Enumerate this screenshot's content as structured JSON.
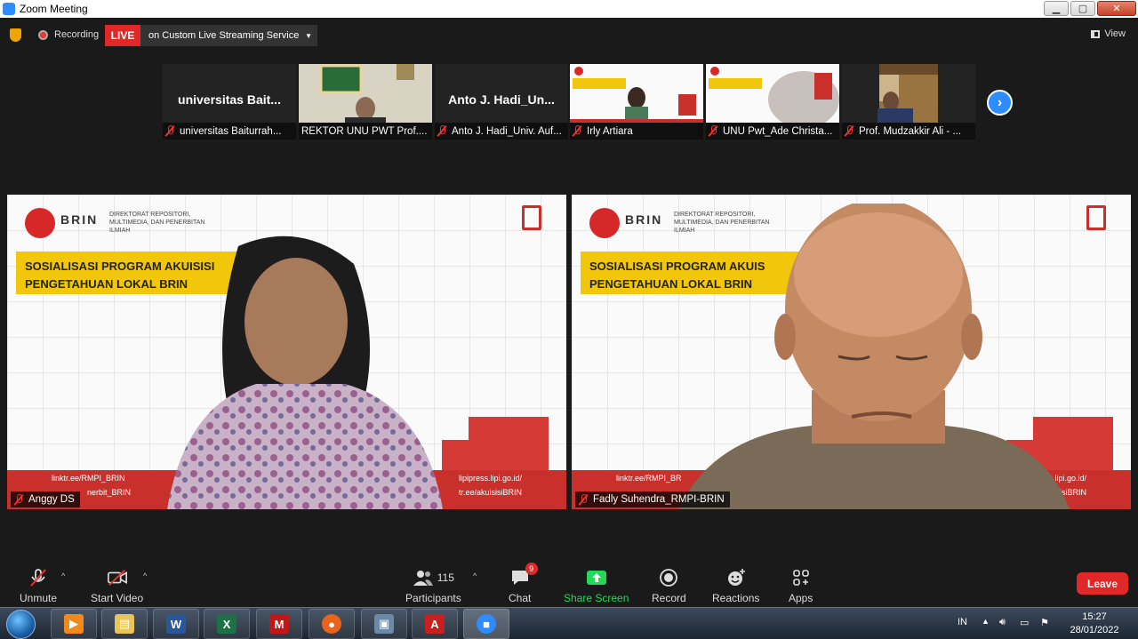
{
  "window": {
    "title": "Zoom Meeting"
  },
  "topbar": {
    "recording_label": "Recording",
    "live_label": "LIVE",
    "live_description": "on Custom Live Streaming Service",
    "view_label": "View"
  },
  "thumbnails": [
    {
      "display_name": "universitas  Bait...",
      "caption": "universitas Baiturrah..."
    },
    {
      "display_name": "",
      "caption": "REKTOR UNU PWT Prof...."
    },
    {
      "display_name": "Anto J. Hadi_Un...",
      "caption": "Anto J. Hadi_Univ. Auf..."
    },
    {
      "display_name": "",
      "caption": "Irly Artiara"
    },
    {
      "display_name": "",
      "caption": "UNU Pwt_Ade Christa..."
    },
    {
      "display_name": "",
      "caption": "Prof. Mudzakkir Ali - ..."
    }
  ],
  "tiles": [
    {
      "brand": "BRIN",
      "org": "DIREKTORAT REPOSITORI, MULTIMEDIA, DAN PENERBITAN ILMIAH",
      "banner_line1": "SOSIALISASI PROGRAM AKUISISI",
      "banner_line2": "PENGETAHUAN LOKAL BRIN",
      "link1": "linktr.ee/RMPI_BRIN",
      "link2": "nerbit_BRIN",
      "link3": "lipipress.lipi.go.id/",
      "link4": "tr.ee/akuisisiBRIN",
      "participant": "Anggy DS"
    },
    {
      "brand": "BRIN",
      "org": "DIREKTORAT REPOSITORI, MULTIMEDIA, DAN PENERBITAN ILMIAH",
      "banner_line1": "SOSIALISASI PROGRAM AKUIS",
      "banner_line2": "PENGETAHUAN LOKAL BRIN",
      "link1": "linktr.ee/RMPI_BR",
      "link3": "ipress.lipi.go.id/",
      "link4": "sisiBRIN",
      "participant": "Fadly Suhendra_RMPI-BRIN"
    }
  ],
  "toolbar": {
    "unmute": "Unmute",
    "start_video": "Start Video",
    "participants_count": "115",
    "participants": "Participants",
    "chat": "Chat",
    "chat_badge": "9",
    "share_screen": "Share Screen",
    "record": "Record",
    "reactions": "Reactions",
    "apps": "Apps",
    "leave": "Leave"
  },
  "taskbar": {
    "language": "IN",
    "time": "15:27",
    "date": "28/01/2022"
  },
  "colors": {
    "zoom_blue": "#2d8cff",
    "live_red": "#e02828",
    "share_green": "#23d959",
    "brin_red": "#c9302c",
    "banner_yellow": "#f2c70b"
  }
}
